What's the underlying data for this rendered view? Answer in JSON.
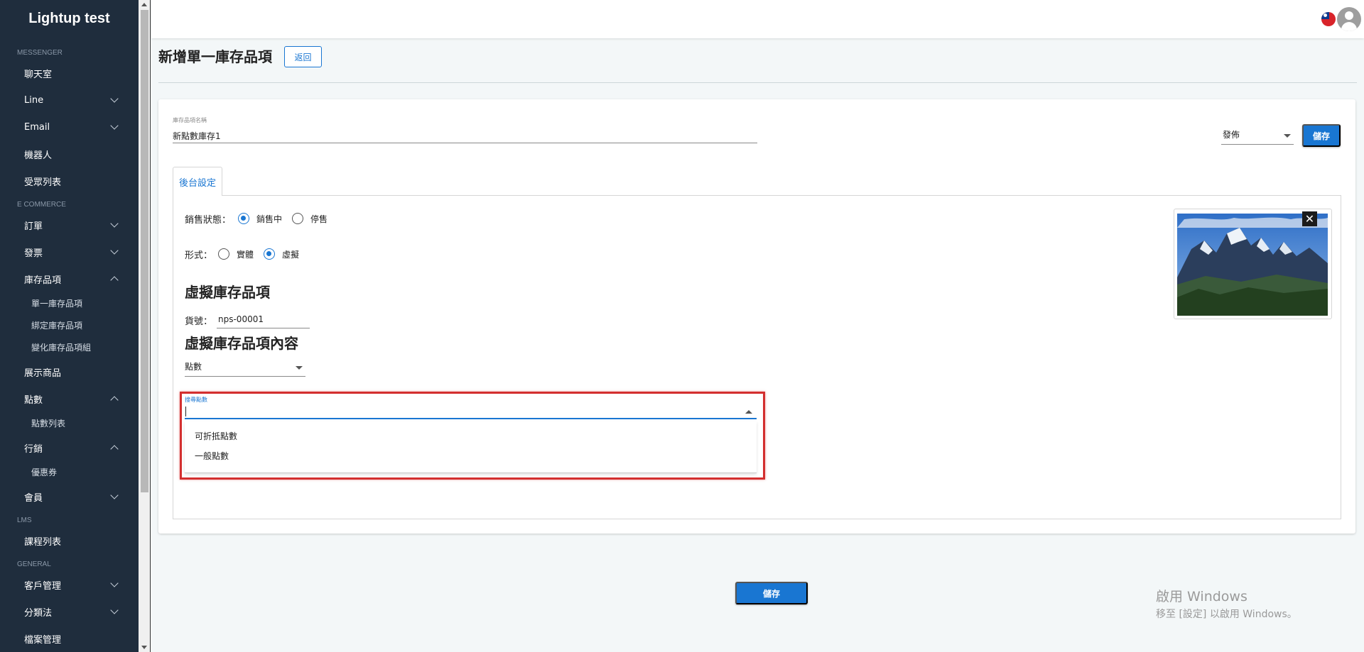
{
  "app": {
    "title": "Lightup test"
  },
  "sidebar": {
    "sections": [
      {
        "header": "MESSENGER"
      },
      {
        "header": "E COMMERCE"
      },
      {
        "header": "LMS"
      },
      {
        "header": "GENERAL"
      }
    ],
    "items": {
      "chatroom": "聊天室",
      "line": "Line",
      "email": "Email",
      "robot": "機器人",
      "audience": "受眾列表",
      "orders": "訂單",
      "invoices": "發票",
      "inventory": "庫存品項",
      "inventory_single": "單一庫存品項",
      "inventory_bundle": "綁定庫存品項",
      "inventory_variant": "變化庫存品項組",
      "showcase": "展示商品",
      "points": "點數",
      "points_list": "點數列表",
      "marketing": "行銷",
      "coupons": "優惠券",
      "members": "會員",
      "courses": "課程列表",
      "customers": "客戶管理",
      "taxonomy": "分類法",
      "files": "檔案管理"
    }
  },
  "header": {
    "flag_icon": "taiwan-flag-icon",
    "avatar_icon": "user-avatar-icon"
  },
  "page": {
    "title": "新增單一庫存品項",
    "back_label": "返回"
  },
  "form": {
    "name_label": "庫存品項名稱",
    "name_value": "新點數庫存1",
    "publish_value": "發佈",
    "save_label": "儲存",
    "tab_label": "後台設定",
    "sales_status_label": "銷售狀態：",
    "sales_status_options": [
      "銷售中",
      "停售"
    ],
    "sales_status_selected": "銷售中",
    "form_type_label": "形式：",
    "form_type_options": [
      "實體",
      "虛擬"
    ],
    "form_type_selected": "虛擬",
    "virtual_heading": "虛擬庫存品項",
    "sku_label": "貨號：",
    "sku_value": "nps-00001",
    "content_heading": "虛擬庫存品項內容",
    "content_type_value": "點數",
    "search_label": "搜尋點數",
    "search_value": "",
    "search_options": [
      "可折抵點數",
      "一般點數"
    ],
    "bottom_save_label": "儲存"
  },
  "image": {
    "close_icon": "close-icon",
    "subject": "mountain-landscape-image"
  },
  "watermark": {
    "line1": "啟用 Windows",
    "line2": "移至 [設定] 以啟用 Windows。"
  }
}
